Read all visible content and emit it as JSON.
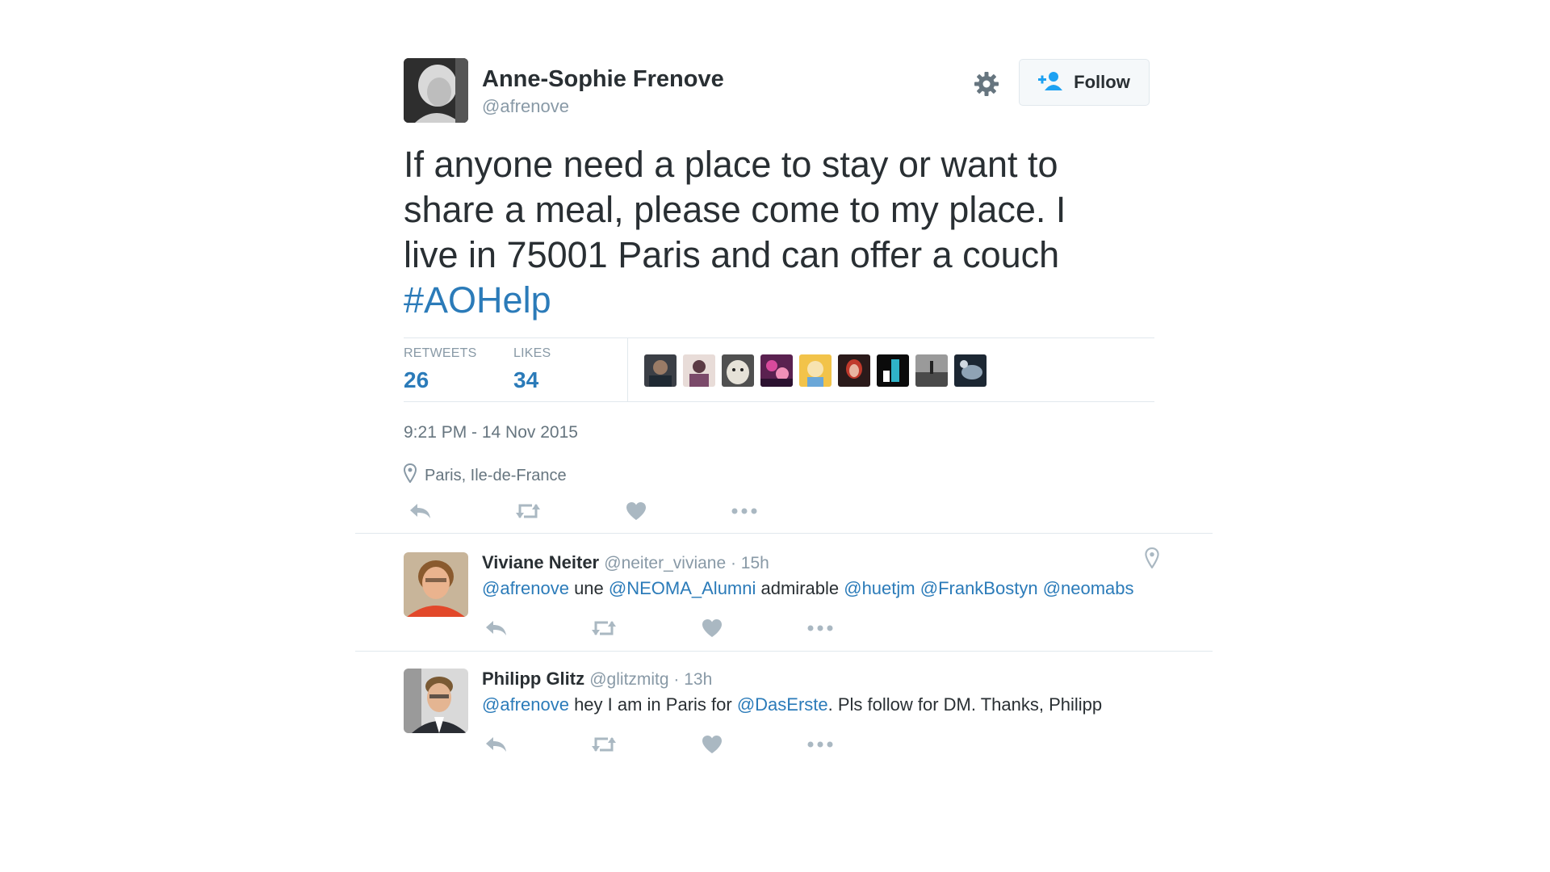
{
  "tweet": {
    "author_name": "Anne-Sophie Frenove",
    "author_handle": "@afrenove",
    "follow_label": "Follow",
    "text_lines": [
      "If anyone need a place to stay or want to",
      "share a meal, please come to my place.  I",
      "live in 75001 Paris and can offer a couch"
    ],
    "hashtag": "#AOHelp",
    "retweets_label": "RETWEETS",
    "retweets_count": "26",
    "likes_label": "LIKES",
    "likes_count": "34",
    "timestamp": "9:21 PM - 14 Nov 2015",
    "location": "Paris, Ile-de-France"
  },
  "likers_count_shown": 9,
  "replies": [
    {
      "name": "Viviane Neiter",
      "meta": "@neiter_viviane · 15h",
      "m1": "@afrenove",
      "t1": " une ",
      "m2": "@NEOMA_Alumni",
      "t2": " admirable ",
      "m3": "@huetjm",
      "t3": " ",
      "m4": "@FrankBostyn",
      "t4": " ",
      "m5": "@neomabs"
    },
    {
      "name": "Philipp Glitz",
      "meta": "@glitzmitg · 13h",
      "m1": "@afrenove",
      "t1": " hey I am in Paris for ",
      "m2": "@DasErste",
      "t2": ". Pls follow for DM. Thanks, Philipp"
    }
  ],
  "colors": {
    "link": "#2b7bb9",
    "text": "#292f33",
    "muted": "#8899a6",
    "icon": "#aab8c2",
    "border": "#e1e8ed"
  },
  "icons": [
    "gear-icon",
    "follow-person-icon",
    "location-pin-icon",
    "reply-icon",
    "retweet-icon",
    "like-icon",
    "more-icon"
  ]
}
